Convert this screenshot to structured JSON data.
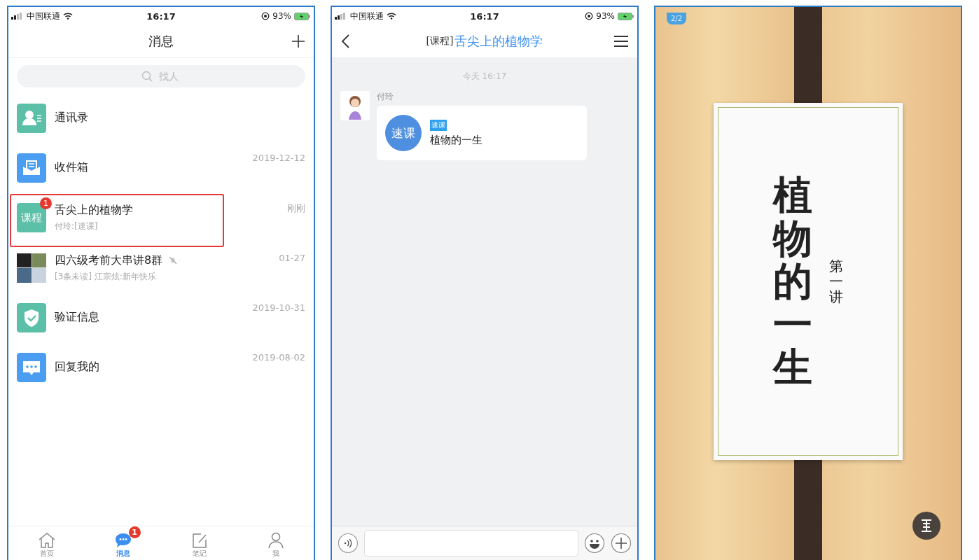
{
  "messages_screen": {
    "status_bar": {
      "carrier": "中国联通",
      "time": "16:17",
      "battery": "93%"
    },
    "title": "消息",
    "search": {
      "placeholder": "找人"
    },
    "conversations": [
      {
        "kind": "contacts",
        "name": "通讯录",
        "muted": false,
        "highlighted": false
      },
      {
        "kind": "inbox",
        "name": "收件箱",
        "time": "2019-12-12",
        "muted": false,
        "highlighted": false
      },
      {
        "kind": "course",
        "icon_label": "课程",
        "name": "舌尖上的植物学",
        "preview": "付玲:[速课]",
        "time": "刚刚",
        "badge": "1",
        "muted": false,
        "highlighted": true
      },
      {
        "kind": "group",
        "name": "四六级考前大串讲8群",
        "preview": "[3条未读] 江宗炫:新年快乐",
        "time": "01-27",
        "muted": true,
        "highlighted": false
      },
      {
        "kind": "verify",
        "name": "验证信息",
        "time": "2019-10-31",
        "muted": false,
        "highlighted": false
      },
      {
        "kind": "reply",
        "name": "回复我的",
        "time": "2019-08-02",
        "muted": false,
        "highlighted": false
      }
    ],
    "tabs": [
      {
        "kind": "home",
        "label": "首页",
        "selected": false
      },
      {
        "kind": "messages",
        "label": "消息",
        "selected": true,
        "badge": "1"
      },
      {
        "kind": "notes",
        "label": "笔记",
        "selected": false
      },
      {
        "kind": "me",
        "label": "我",
        "selected": false
      }
    ]
  },
  "chat_screen": {
    "status_bar": {
      "carrier": "中国联通",
      "time": "16:17",
      "battery": "93%"
    },
    "title_prefix": "[课程]",
    "title": "舌尖上的植物学",
    "timestamp": "今天 16:17",
    "message": {
      "sender": "付玲",
      "card_icon_label": "速课",
      "tag": "速课",
      "text": "植物的一生"
    }
  },
  "slide_screen": {
    "page": "2/2",
    "title": "植物的一生",
    "subtitle": "第一讲"
  }
}
